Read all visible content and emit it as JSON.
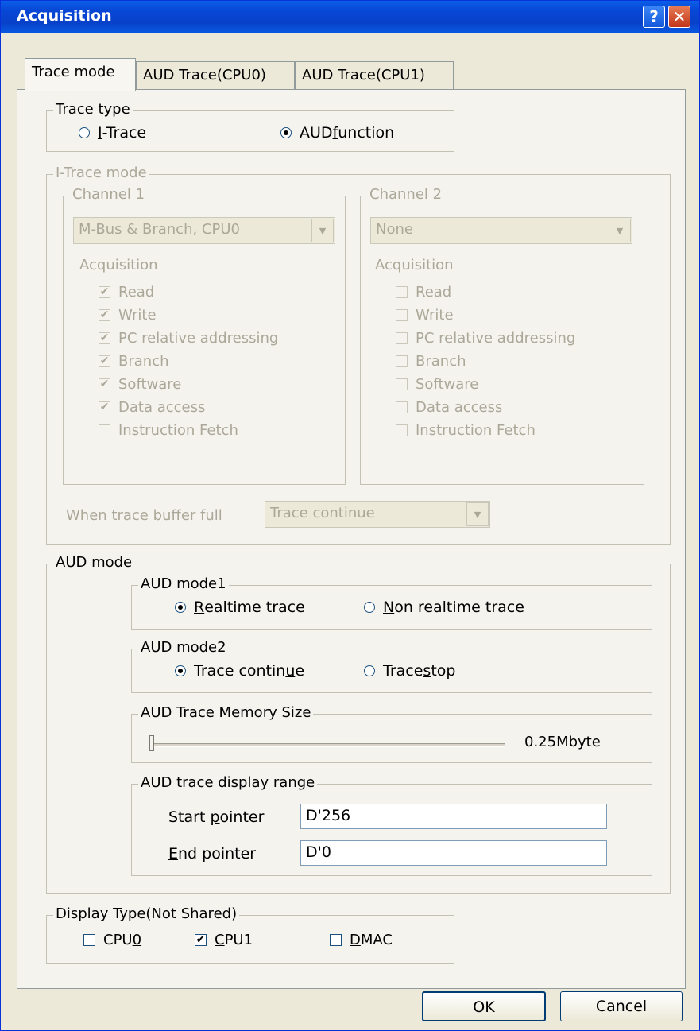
{
  "window": {
    "title": "Acquisition",
    "help_glyph": "?",
    "close_glyph": "✕"
  },
  "tabs": [
    "Trace mode",
    "AUD Trace(CPU0)",
    "AUD Trace(CPU1)"
  ],
  "trace_type": {
    "legend": "Trace type",
    "options": [
      {
        "pre": "",
        "ul": "I",
        "post": "-Trace",
        "selected": false
      },
      {
        "pre": "AUD ",
        "ul": "f",
        "post": "unction",
        "selected": true
      }
    ]
  },
  "itrace_mode": {
    "legend": "I-Trace mode",
    "channel1": {
      "legend_pre": "Channel ",
      "legend_ul": "1",
      "dropdown": "M-Bus & Branch, CPU0",
      "acquisition_label": "Acquisition",
      "items": [
        {
          "label": "Read",
          "checked": true
        },
        {
          "label": "Write",
          "checked": true
        },
        {
          "label": "PC relative addressing",
          "checked": true
        },
        {
          "label": "Branch",
          "checked": true
        },
        {
          "label": "Software",
          "checked": true
        },
        {
          "label": "Data access",
          "checked": true
        },
        {
          "label": "Instruction Fetch",
          "checked": false
        }
      ]
    },
    "channel2": {
      "legend_pre": "Channel ",
      "legend_ul": "2",
      "dropdown": "None",
      "acquisition_label": "Acquisition",
      "items": [
        {
          "label": "Read",
          "checked": false
        },
        {
          "label": "Write",
          "checked": false
        },
        {
          "label": "PC relative addressing",
          "checked": false
        },
        {
          "label": "Branch",
          "checked": false
        },
        {
          "label": "Software",
          "checked": false
        },
        {
          "label": "Data access",
          "checked": false
        },
        {
          "label": "Instruction Fetch",
          "checked": false
        }
      ]
    },
    "buffer_full_pre": "When trace buffer ful",
    "buffer_full_ul": "l",
    "buffer_full_value": "Trace continue"
  },
  "aud_mode": {
    "legend": "AUD mode",
    "mode1": {
      "legend": "AUD mode1",
      "options": [
        {
          "pre": "",
          "ul": "R",
          "post": "ealtime trace",
          "selected": true
        },
        {
          "pre": "",
          "ul": "N",
          "post": "on realtime trace",
          "selected": false
        }
      ]
    },
    "mode2": {
      "legend": "AUD mode2",
      "options": [
        {
          "pre": "Trace contin",
          "ul": "u",
          "post": "e",
          "selected": true
        },
        {
          "pre": "Trace ",
          "ul": "s",
          "post": "top",
          "selected": false
        }
      ]
    },
    "memory_size": {
      "legend": "AUD Trace Memory Size",
      "value_label": "0.25Mbyte",
      "slider_level": 0
    },
    "display_range": {
      "legend": "AUD trace display range",
      "start": {
        "pre": "Start ",
        "ul": "p",
        "post": "ointer",
        "value": "D'256"
      },
      "end": {
        "pre": "",
        "ul": "E",
        "post": "nd pointer",
        "value": "D'0"
      }
    }
  },
  "display_type": {
    "legend": "Display Type(Not Shared)",
    "options": [
      {
        "pre": "CPU",
        "ul": "0",
        "post": "",
        "checked": false
      },
      {
        "pre": "",
        "ul": "C",
        "post": "PU1",
        "checked": true
      },
      {
        "pre": "",
        "ul": "D",
        "post": "MAC",
        "checked": false
      }
    ]
  },
  "buttons": {
    "ok": "OK",
    "cancel": "Cancel"
  },
  "colors": {
    "title_bar": "#0847d6",
    "dialog_bg": "#ece9d8",
    "disabled_text": "#aca899"
  },
  "icons": {
    "help": "help-icon",
    "close": "close-icon",
    "dropdown": "chevron-down-icon",
    "check": "checkmark-icon"
  }
}
